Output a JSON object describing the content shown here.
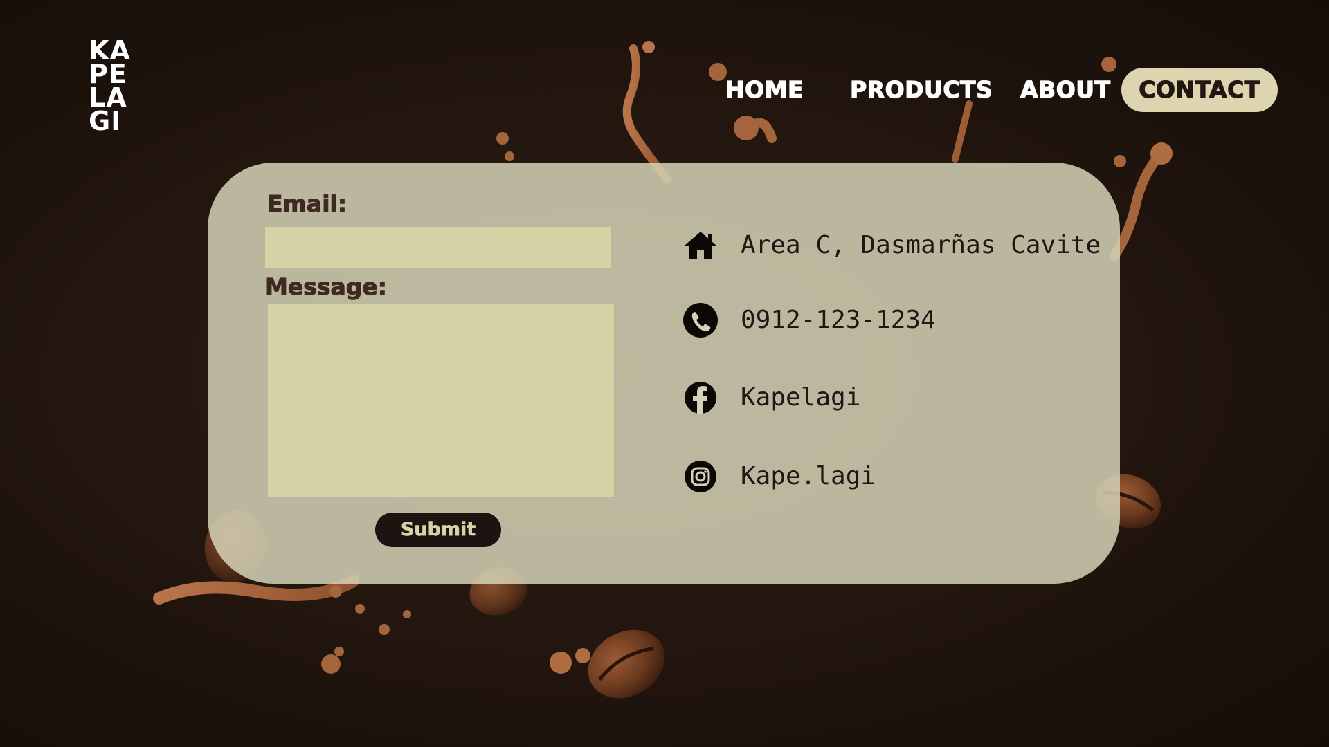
{
  "logo": {
    "line1": "KA",
    "line2": "PE",
    "line3": "LA",
    "line4": "GI"
  },
  "nav": {
    "items": [
      {
        "label": "HOME"
      },
      {
        "label": "PRODUCTS"
      },
      {
        "label": "ABOUT"
      },
      {
        "label": "CONTACT",
        "active": true
      }
    ]
  },
  "form": {
    "email_label": "Email:",
    "email_value": "",
    "message_label": "Message:",
    "message_value": "",
    "submit_label": "Submit"
  },
  "contact_info": [
    {
      "icon": "home-icon",
      "text": "Area C, Dasmarñas Cavite"
    },
    {
      "icon": "phone-icon",
      "text": "0912-123-1234"
    },
    {
      "icon": "facebook-icon",
      "text": "Kapelagi"
    },
    {
      "icon": "instagram-icon",
      "text": "Kape.lagi"
    }
  ],
  "colors": {
    "background": "#1f140e",
    "card": "#d4d2b6",
    "input": "#d7d1a6",
    "active_nav": "#dcd5b0",
    "dark_text": "#3d2a20",
    "submit_bg": "#1c1410"
  }
}
